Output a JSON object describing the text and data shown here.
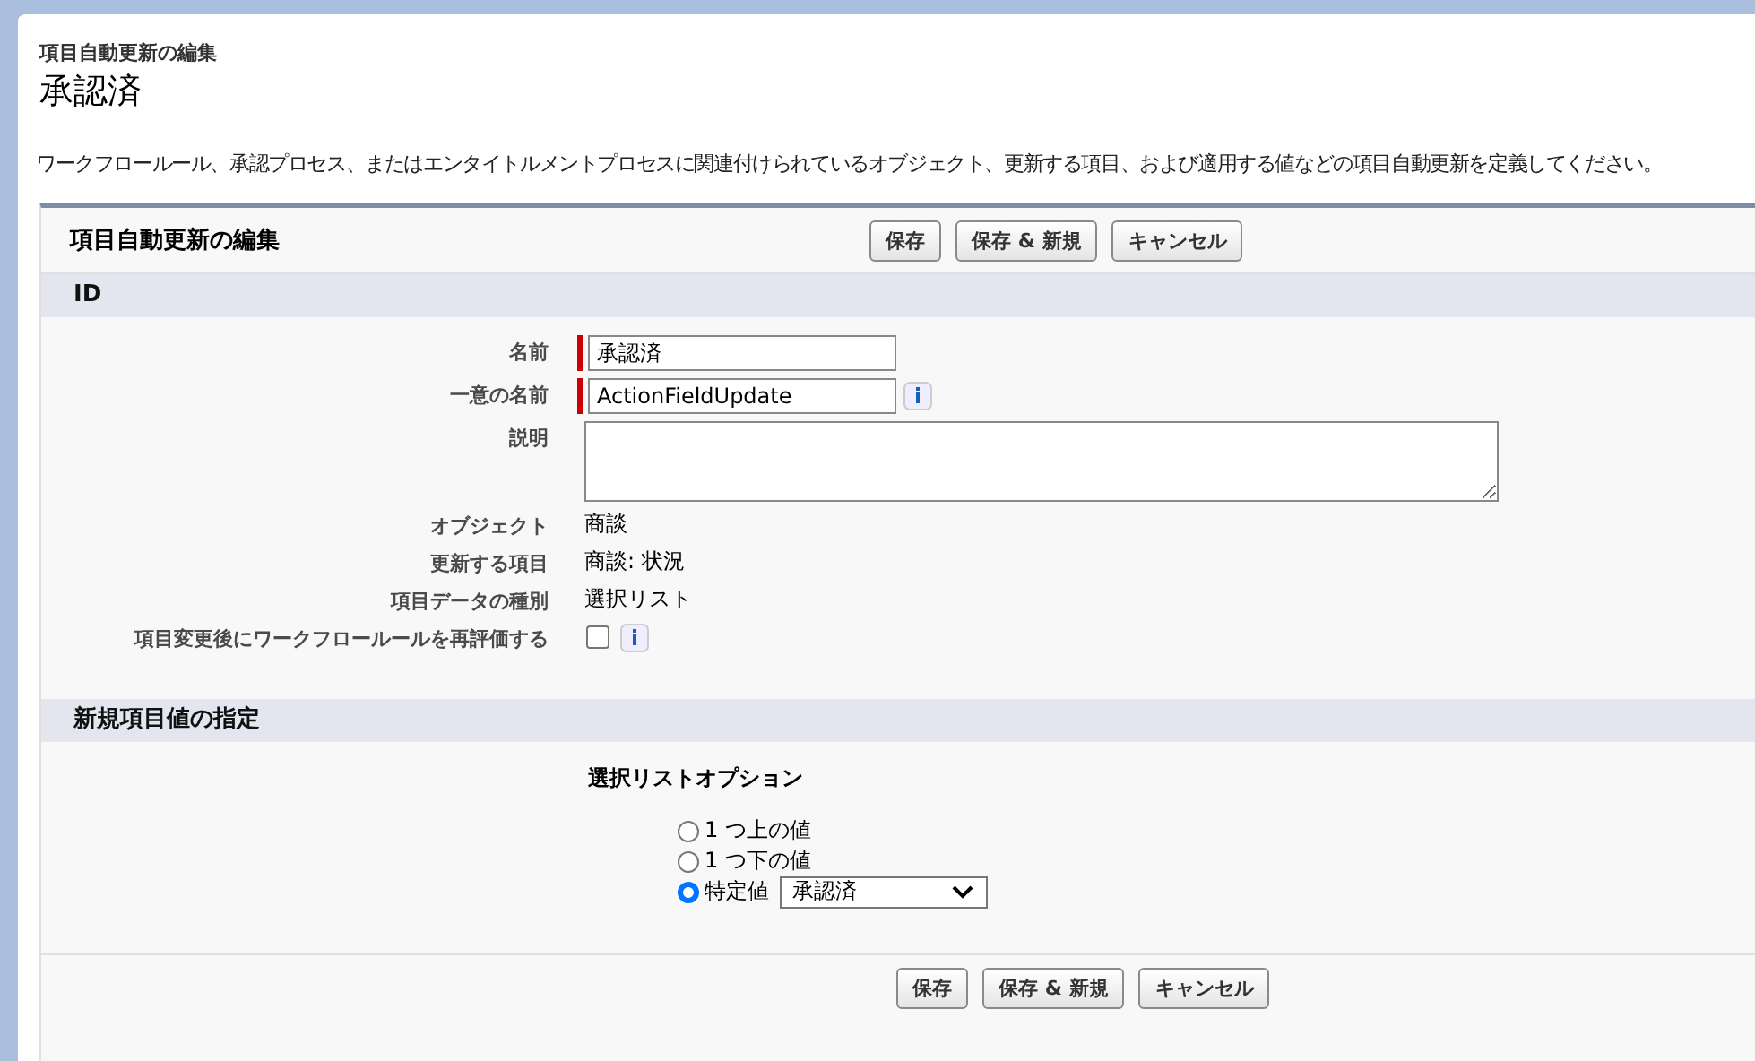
{
  "page": {
    "breadcrumb": "項目自動更新の編集",
    "title": "承認済",
    "description": "ワークフロールール、承認プロセス、またはエンタイトルメントプロセスに関連付けられているオブジェクト、更新する項目、および適用する値などの項目自動更新を定義してください。"
  },
  "panel": {
    "title": "項目自動更新の編集",
    "buttons": [
      "保存",
      "保存 & 新規",
      "キャンセル"
    ],
    "bottom_buttons": [
      "保存",
      "保存 & 新規",
      "キャンセル"
    ]
  },
  "sections": [
    {
      "title": "ID",
      "fields": [
        {
          "kind": "input",
          "label": "名前",
          "value": "承認済",
          "required": true,
          "info": false
        },
        {
          "kind": "input",
          "label": "一意の名前",
          "value": "ActionFieldUpdate",
          "required": true,
          "info": true
        },
        {
          "kind": "textarea",
          "label": "説明"
        },
        {
          "kind": "text",
          "label": "オブジェクト",
          "value": "商談"
        },
        {
          "kind": "text",
          "label": "更新する項目",
          "value": "商談: 状況"
        },
        {
          "kind": "text",
          "label": "項目データの種別",
          "value": "選択リスト"
        },
        {
          "kind": "checkbox",
          "label": "項目変更後にワークフロールールを再評価する",
          "checked": false,
          "info": true
        }
      ]
    },
    {
      "title": "新規項目値の指定",
      "options_title": "選択リストオプション",
      "options": [
        {
          "label": "1 つ上の値",
          "selected": false
        },
        {
          "label": "1 つ下の値",
          "selected": false
        },
        {
          "label": "特定値",
          "selected": true,
          "select_value": "承認済"
        }
      ]
    }
  ]
}
